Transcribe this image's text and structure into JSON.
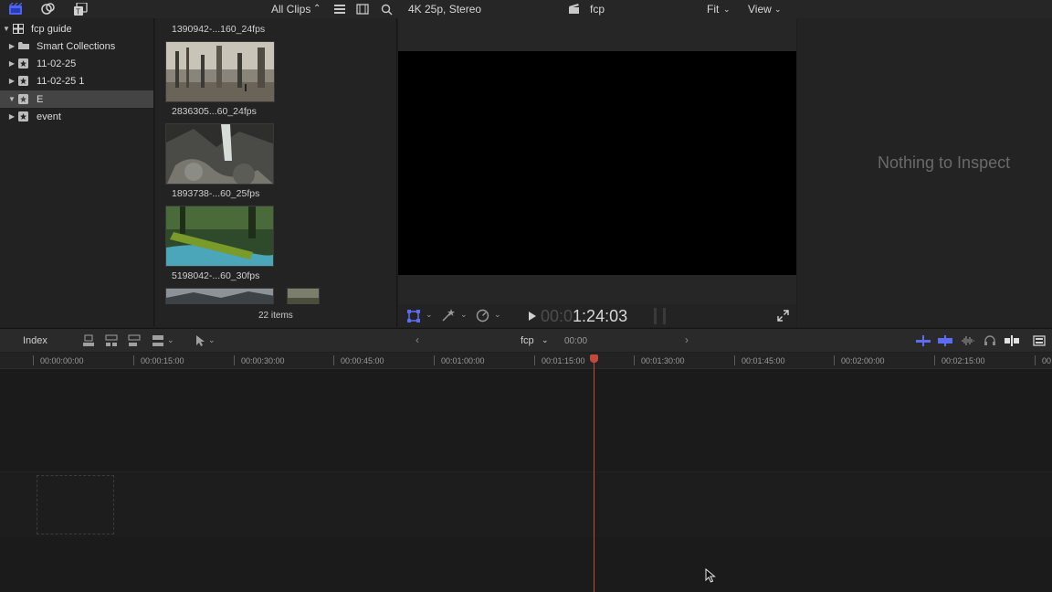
{
  "topbar": {
    "clip_filter": "All Clips",
    "format": "4K 25p, Stereo",
    "project_name": "fcp",
    "fit_menu": "Fit",
    "view_menu": "View"
  },
  "libraries": {
    "items": [
      {
        "label": "fcp guide",
        "expanded": true,
        "icon": "library-icon"
      },
      {
        "label": "Smart Collections",
        "expanded": false,
        "icon": "folder-icon"
      },
      {
        "label": "11-02-25",
        "expanded": false,
        "icon": "event-icon"
      },
      {
        "label": "11-02-25 1",
        "expanded": false,
        "icon": "event-icon"
      },
      {
        "label": "E",
        "expanded": true,
        "icon": "event-icon",
        "selected": true
      },
      {
        "label": "event",
        "expanded": false,
        "icon": "event-icon"
      }
    ]
  },
  "browser": {
    "clips": [
      {
        "name": "1390942-...160_24fps"
      },
      {
        "name": "2836305...60_24fps"
      },
      {
        "name": "1893738-...60_25fps"
      },
      {
        "name": "5198042-...60_30fps"
      }
    ],
    "items_count": "22 items"
  },
  "viewer": {
    "timecode_dim": "00:0",
    "timecode": "1:24:03"
  },
  "inspector": {
    "empty_message": "Nothing to Inspect"
  },
  "timeline_bar": {
    "index_label": "Index",
    "project_name": "fcp",
    "duration": "00:00"
  },
  "ruler": {
    "ticks": [
      "00:00:00:00",
      "00:00:15:00",
      "00:00:30:00",
      "00:00:45:00",
      "00:01:00:00",
      "00:01:15:00",
      "00:01:30:00",
      "00:01:45:00",
      "00:02:00:00",
      "00:02:15:00",
      "00"
    ]
  },
  "colors": {
    "accent": "#5b6cf0",
    "playhead": "#c24a3a",
    "selected_row": "#444444"
  }
}
